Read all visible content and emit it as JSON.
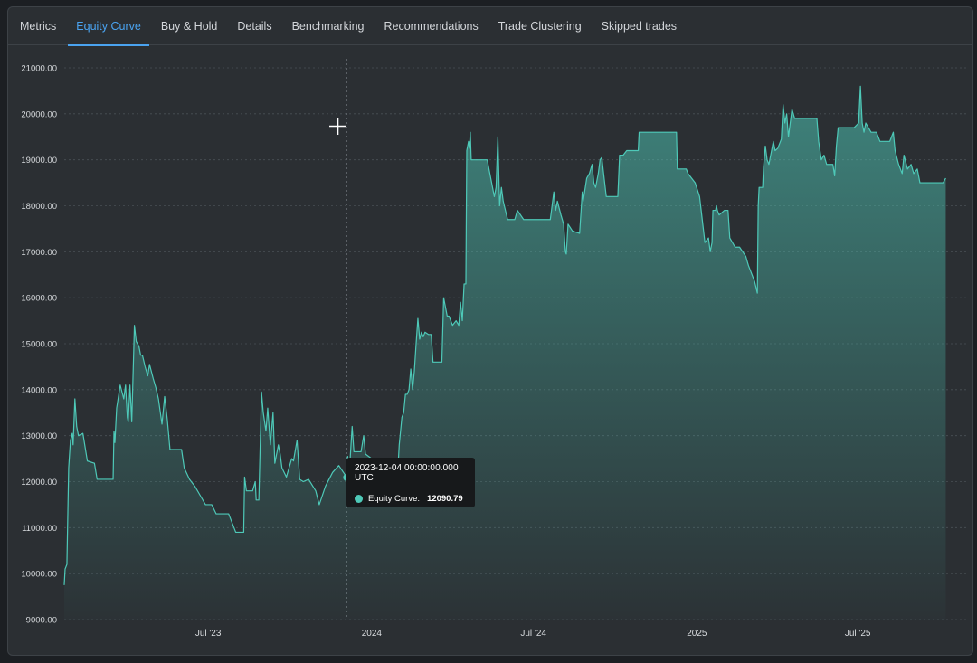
{
  "tabs": [
    {
      "label": "Metrics",
      "active": false
    },
    {
      "label": "Equity Curve",
      "active": true
    },
    {
      "label": "Buy & Hold",
      "active": false
    },
    {
      "label": "Details",
      "active": false
    },
    {
      "label": "Benchmarking",
      "active": false
    },
    {
      "label": "Recommendations",
      "active": false
    },
    {
      "label": "Trade Clustering",
      "active": false
    },
    {
      "label": "Skipped trades",
      "active": false
    }
  ],
  "tooltip": {
    "date": "2023-12-04 00:00:00.000 UTC",
    "series_label": "Equity Curve:",
    "value": "12090.79"
  },
  "colors": {
    "line": "#4ec9b8",
    "accent": "#4aa3f0",
    "background": "#2b2f33"
  },
  "chart_data": {
    "type": "area",
    "y_ticks": [
      "21000.00",
      "20000.00",
      "19000.00",
      "18000.00",
      "17000.00",
      "16000.00",
      "15000.00",
      "14000.00",
      "13000.00",
      "12000.00",
      "11000.00",
      "10000.00",
      "9000.00"
    ],
    "ylim": [
      9000,
      21000
    ],
    "x_tick_labels": [
      "Jul '23",
      "2024",
      "Jul '24",
      "2025",
      "Jul '25"
    ],
    "x_tick_dates": [
      "2023-07-01",
      "2024-01-01",
      "2024-07-01",
      "2025-01-01",
      "2025-07-01"
    ],
    "xlim": [
      "2023-01-20",
      "2025-11-01"
    ],
    "grid": true,
    "hover_date": "2023-12-04",
    "series": [
      {
        "values": [
          [
            "2023-01-20",
            9750
          ],
          [
            "2023-01-21",
            10100
          ],
          [
            "2023-01-23",
            10200
          ],
          [
            "2023-01-25",
            12300
          ],
          [
            "2023-01-27",
            12900
          ],
          [
            "2023-01-29",
            13050
          ],
          [
            "2023-01-30",
            12800
          ],
          [
            "2023-02-01",
            13800
          ],
          [
            "2023-02-03",
            13200
          ],
          [
            "2023-02-05",
            13000
          ],
          [
            "2023-02-10",
            13050
          ],
          [
            "2023-02-15",
            12450
          ],
          [
            "2023-02-23",
            12400
          ],
          [
            "2023-02-26",
            12050
          ],
          [
            "2023-03-01",
            12050
          ],
          [
            "2023-03-16",
            12050
          ],
          [
            "2023-03-17",
            13100
          ],
          [
            "2023-03-18",
            12850
          ],
          [
            "2023-03-20",
            13600
          ],
          [
            "2023-03-24",
            14100
          ],
          [
            "2023-03-28",
            13800
          ],
          [
            "2023-03-30",
            14100
          ],
          [
            "2023-04-01",
            13400
          ],
          [
            "2023-04-02",
            13300
          ],
          [
            "2023-04-04",
            14100
          ],
          [
            "2023-04-06",
            13300
          ],
          [
            "2023-04-09",
            15400
          ],
          [
            "2023-04-11",
            15050
          ],
          [
            "2023-04-14",
            14950
          ],
          [
            "2023-04-16",
            14750
          ],
          [
            "2023-04-18",
            14750
          ],
          [
            "2023-04-21",
            14500
          ],
          [
            "2023-04-24",
            14300
          ],
          [
            "2023-04-26",
            14550
          ],
          [
            "2023-04-30",
            14250
          ],
          [
            "2023-05-03",
            14050
          ],
          [
            "2023-05-06",
            13800
          ],
          [
            "2023-05-10",
            13250
          ],
          [
            "2023-05-13",
            13850
          ],
          [
            "2023-05-16",
            13350
          ],
          [
            "2023-05-19",
            12700
          ],
          [
            "2023-05-26",
            12700
          ],
          [
            "2023-06-01",
            12700
          ],
          [
            "2023-06-04",
            12300
          ],
          [
            "2023-06-10",
            12050
          ],
          [
            "2023-06-16",
            11900
          ],
          [
            "2023-06-22",
            11700
          ],
          [
            "2023-06-28",
            11500
          ],
          [
            "2023-07-05",
            11500
          ],
          [
            "2023-07-10",
            11300
          ],
          [
            "2023-07-18",
            11300
          ],
          [
            "2023-07-24",
            11300
          ],
          [
            "2023-07-30",
            11000
          ],
          [
            "2023-08-01",
            10900
          ],
          [
            "2023-08-10",
            10900
          ],
          [
            "2023-08-11",
            12100
          ],
          [
            "2023-08-13",
            11800
          ],
          [
            "2023-08-20",
            11800
          ],
          [
            "2023-08-23",
            12000
          ],
          [
            "2023-08-24",
            11600
          ],
          [
            "2023-08-27",
            11600
          ],
          [
            "2023-08-30",
            13950
          ],
          [
            "2023-09-01",
            13500
          ],
          [
            "2023-09-04",
            13100
          ],
          [
            "2023-09-06",
            13600
          ],
          [
            "2023-09-09",
            12800
          ],
          [
            "2023-09-12",
            13500
          ],
          [
            "2023-09-14",
            12400
          ],
          [
            "2023-09-18",
            12800
          ],
          [
            "2023-09-20",
            12600
          ],
          [
            "2023-09-22",
            12300
          ],
          [
            "2023-09-27",
            12100
          ],
          [
            "2023-10-03",
            12500
          ],
          [
            "2023-10-05",
            12450
          ],
          [
            "2023-10-09",
            12900
          ],
          [
            "2023-10-12",
            12050
          ],
          [
            "2023-10-16",
            12000
          ],
          [
            "2023-10-22",
            12050
          ],
          [
            "2023-10-30",
            11800
          ],
          [
            "2023-11-03",
            11500
          ],
          [
            "2023-11-10",
            11900
          ],
          [
            "2023-11-18",
            12200
          ],
          [
            "2023-11-25",
            12350
          ],
          [
            "2023-12-04",
            12090.79
          ],
          [
            "2023-12-05",
            12550
          ],
          [
            "2023-12-07",
            12250
          ],
          [
            "2023-12-10",
            13200
          ],
          [
            "2023-12-12",
            12650
          ],
          [
            "2023-12-20",
            12650
          ],
          [
            "2023-12-23",
            13000
          ],
          [
            "2023-12-25",
            12600
          ],
          [
            "2024-01-01",
            12500
          ],
          [
            "2024-01-05",
            11600
          ],
          [
            "2024-01-08",
            11500
          ],
          [
            "2024-01-12",
            11700
          ],
          [
            "2024-01-16",
            11600
          ],
          [
            "2024-01-20",
            11600
          ],
          [
            "2024-01-25",
            11900
          ],
          [
            "2024-01-30",
            12100
          ],
          [
            "2024-02-01",
            12800
          ],
          [
            "2024-02-04",
            13400
          ],
          [
            "2024-02-06",
            13500
          ],
          [
            "2024-02-08",
            13900
          ],
          [
            "2024-02-10",
            13900
          ],
          [
            "2024-02-12",
            14000
          ],
          [
            "2024-02-14",
            14450
          ],
          [
            "2024-02-16",
            14000
          ],
          [
            "2024-02-18",
            14400
          ],
          [
            "2024-02-20",
            15000
          ],
          [
            "2024-02-22",
            15550
          ],
          [
            "2024-02-24",
            15100
          ],
          [
            "2024-02-26",
            15250
          ],
          [
            "2024-02-28",
            15150
          ],
          [
            "2024-03-01",
            15250
          ],
          [
            "2024-03-05",
            15200
          ],
          [
            "2024-03-08",
            15200
          ],
          [
            "2024-03-10",
            14600
          ],
          [
            "2024-03-20",
            14600
          ],
          [
            "2024-03-22",
            16000
          ],
          [
            "2024-03-24",
            15800
          ],
          [
            "2024-03-26",
            15600
          ],
          [
            "2024-03-28",
            15600
          ],
          [
            "2024-04-01",
            15400
          ],
          [
            "2024-04-05",
            15500
          ],
          [
            "2024-04-08",
            15400
          ],
          [
            "2024-04-10",
            15900
          ],
          [
            "2024-04-12",
            15500
          ],
          [
            "2024-04-14",
            16300
          ],
          [
            "2024-04-16",
            16300
          ],
          [
            "2024-04-17",
            19200
          ],
          [
            "2024-04-19",
            19400
          ],
          [
            "2024-04-20",
            19250
          ],
          [
            "2024-04-21",
            19600
          ],
          [
            "2024-04-22",
            19000
          ],
          [
            "2024-05-01",
            19000
          ],
          [
            "2024-05-10",
            19000
          ],
          [
            "2024-05-14",
            18600
          ],
          [
            "2024-05-18",
            18200
          ],
          [
            "2024-05-20",
            18400
          ],
          [
            "2024-05-22",
            19500
          ],
          [
            "2024-05-24",
            18000
          ],
          [
            "2024-05-26",
            18400
          ],
          [
            "2024-05-28",
            18100
          ],
          [
            "2024-06-02",
            17700
          ],
          [
            "2024-06-10",
            17700
          ],
          [
            "2024-06-13",
            17900
          ],
          [
            "2024-06-20",
            17700
          ],
          [
            "2024-06-30",
            17700
          ],
          [
            "2024-07-10",
            17700
          ],
          [
            "2024-07-20",
            17700
          ],
          [
            "2024-07-24",
            18300
          ],
          [
            "2024-07-26",
            17900
          ],
          [
            "2024-07-28",
            18100
          ],
          [
            "2024-08-01",
            17800
          ],
          [
            "2024-08-04",
            17600
          ],
          [
            "2024-08-06",
            17000
          ],
          [
            "2024-08-07",
            16950
          ],
          [
            "2024-08-09",
            17600
          ],
          [
            "2024-08-14",
            17450
          ],
          [
            "2024-08-22",
            17400
          ],
          [
            "2024-08-25",
            18300
          ],
          [
            "2024-08-26",
            18100
          ],
          [
            "2024-08-30",
            18600
          ],
          [
            "2024-09-02",
            18700
          ],
          [
            "2024-09-05",
            18900
          ],
          [
            "2024-09-07",
            18500
          ],
          [
            "2024-09-09",
            18400
          ],
          [
            "2024-09-12",
            18700
          ],
          [
            "2024-09-14",
            19000
          ],
          [
            "2024-09-16",
            19050
          ],
          [
            "2024-09-18",
            18700
          ],
          [
            "2024-09-21",
            18200
          ],
          [
            "2024-09-25",
            18200
          ],
          [
            "2024-10-01",
            18200
          ],
          [
            "2024-10-04",
            18200
          ],
          [
            "2024-10-06",
            19100
          ],
          [
            "2024-10-10",
            19100
          ],
          [
            "2024-10-14",
            19200
          ],
          [
            "2024-10-20",
            19200
          ],
          [
            "2024-10-27",
            19200
          ],
          [
            "2024-10-28",
            19600
          ],
          [
            "2024-11-10",
            19600
          ],
          [
            "2024-11-24",
            19600
          ],
          [
            "2024-12-09",
            19600
          ],
          [
            "2024-12-10",
            18800
          ],
          [
            "2024-12-20",
            18800
          ],
          [
            "2024-12-22",
            18700
          ],
          [
            "2024-12-30",
            18500
          ],
          [
            "2025-01-04",
            18200
          ],
          [
            "2025-01-07",
            17700
          ],
          [
            "2025-01-10",
            17200
          ],
          [
            "2025-01-14",
            17300
          ],
          [
            "2025-01-16",
            17000
          ],
          [
            "2025-01-18",
            17200
          ],
          [
            "2025-01-19",
            17900
          ],
          [
            "2025-01-20",
            17900
          ],
          [
            "2025-01-22",
            17900
          ],
          [
            "2025-01-23",
            18000
          ],
          [
            "2025-01-24",
            17900
          ],
          [
            "2025-01-26",
            17800
          ],
          [
            "2025-02-01",
            17900
          ],
          [
            "2025-02-05",
            17900
          ],
          [
            "2025-02-07",
            17300
          ],
          [
            "2025-02-13",
            17100
          ],
          [
            "2025-02-18",
            17100
          ],
          [
            "2025-02-25",
            16900
          ],
          [
            "2025-02-28",
            16700
          ],
          [
            "2025-03-04",
            16500
          ],
          [
            "2025-03-07",
            16350
          ],
          [
            "2025-03-10",
            16100
          ],
          [
            "2025-03-11",
            18000
          ],
          [
            "2025-03-12",
            18400
          ],
          [
            "2025-03-16",
            18400
          ],
          [
            "2025-03-17",
            18850
          ],
          [
            "2025-03-19",
            19300
          ],
          [
            "2025-03-21",
            19000
          ],
          [
            "2025-03-23",
            18900
          ],
          [
            "2025-03-25",
            19100
          ],
          [
            "2025-03-28",
            19400
          ],
          [
            "2025-03-30",
            19200
          ],
          [
            "2025-04-02",
            19250
          ],
          [
            "2025-04-06",
            19450
          ],
          [
            "2025-04-08",
            20200
          ],
          [
            "2025-04-10",
            19800
          ],
          [
            "2025-04-12",
            20000
          ],
          [
            "2025-04-14",
            19500
          ],
          [
            "2025-04-18",
            20100
          ],
          [
            "2025-04-21",
            19900
          ],
          [
            "2025-05-10",
            19900
          ],
          [
            "2025-05-16",
            19900
          ],
          [
            "2025-05-18",
            19400
          ],
          [
            "2025-05-21",
            19000
          ],
          [
            "2025-05-24",
            19100
          ],
          [
            "2025-05-27",
            18900
          ],
          [
            "2025-06-03",
            18900
          ],
          [
            "2025-06-05",
            18650
          ],
          [
            "2025-06-07",
            19300
          ],
          [
            "2025-06-09",
            19700
          ],
          [
            "2025-06-15",
            19700
          ],
          [
            "2025-06-27",
            19700
          ],
          [
            "2025-07-02",
            19800
          ],
          [
            "2025-07-04",
            20600
          ],
          [
            "2025-07-06",
            19800
          ],
          [
            "2025-07-08",
            19600
          ],
          [
            "2025-07-10",
            19800
          ],
          [
            "2025-07-16",
            19600
          ],
          [
            "2025-07-22",
            19600
          ],
          [
            "2025-07-26",
            19400
          ],
          [
            "2025-08-02",
            19400
          ],
          [
            "2025-08-06",
            19400
          ],
          [
            "2025-08-10",
            19600
          ],
          [
            "2025-08-12",
            19200
          ],
          [
            "2025-08-16",
            18900
          ],
          [
            "2025-08-20",
            18700
          ],
          [
            "2025-08-22",
            19100
          ],
          [
            "2025-08-26",
            18800
          ],
          [
            "2025-08-30",
            18900
          ],
          [
            "2025-09-02",
            18700
          ],
          [
            "2025-09-06",
            18800
          ],
          [
            "2025-09-09",
            18500
          ],
          [
            "2025-10-05",
            18500
          ],
          [
            "2025-10-08",
            18600
          ]
        ]
      }
    ]
  }
}
